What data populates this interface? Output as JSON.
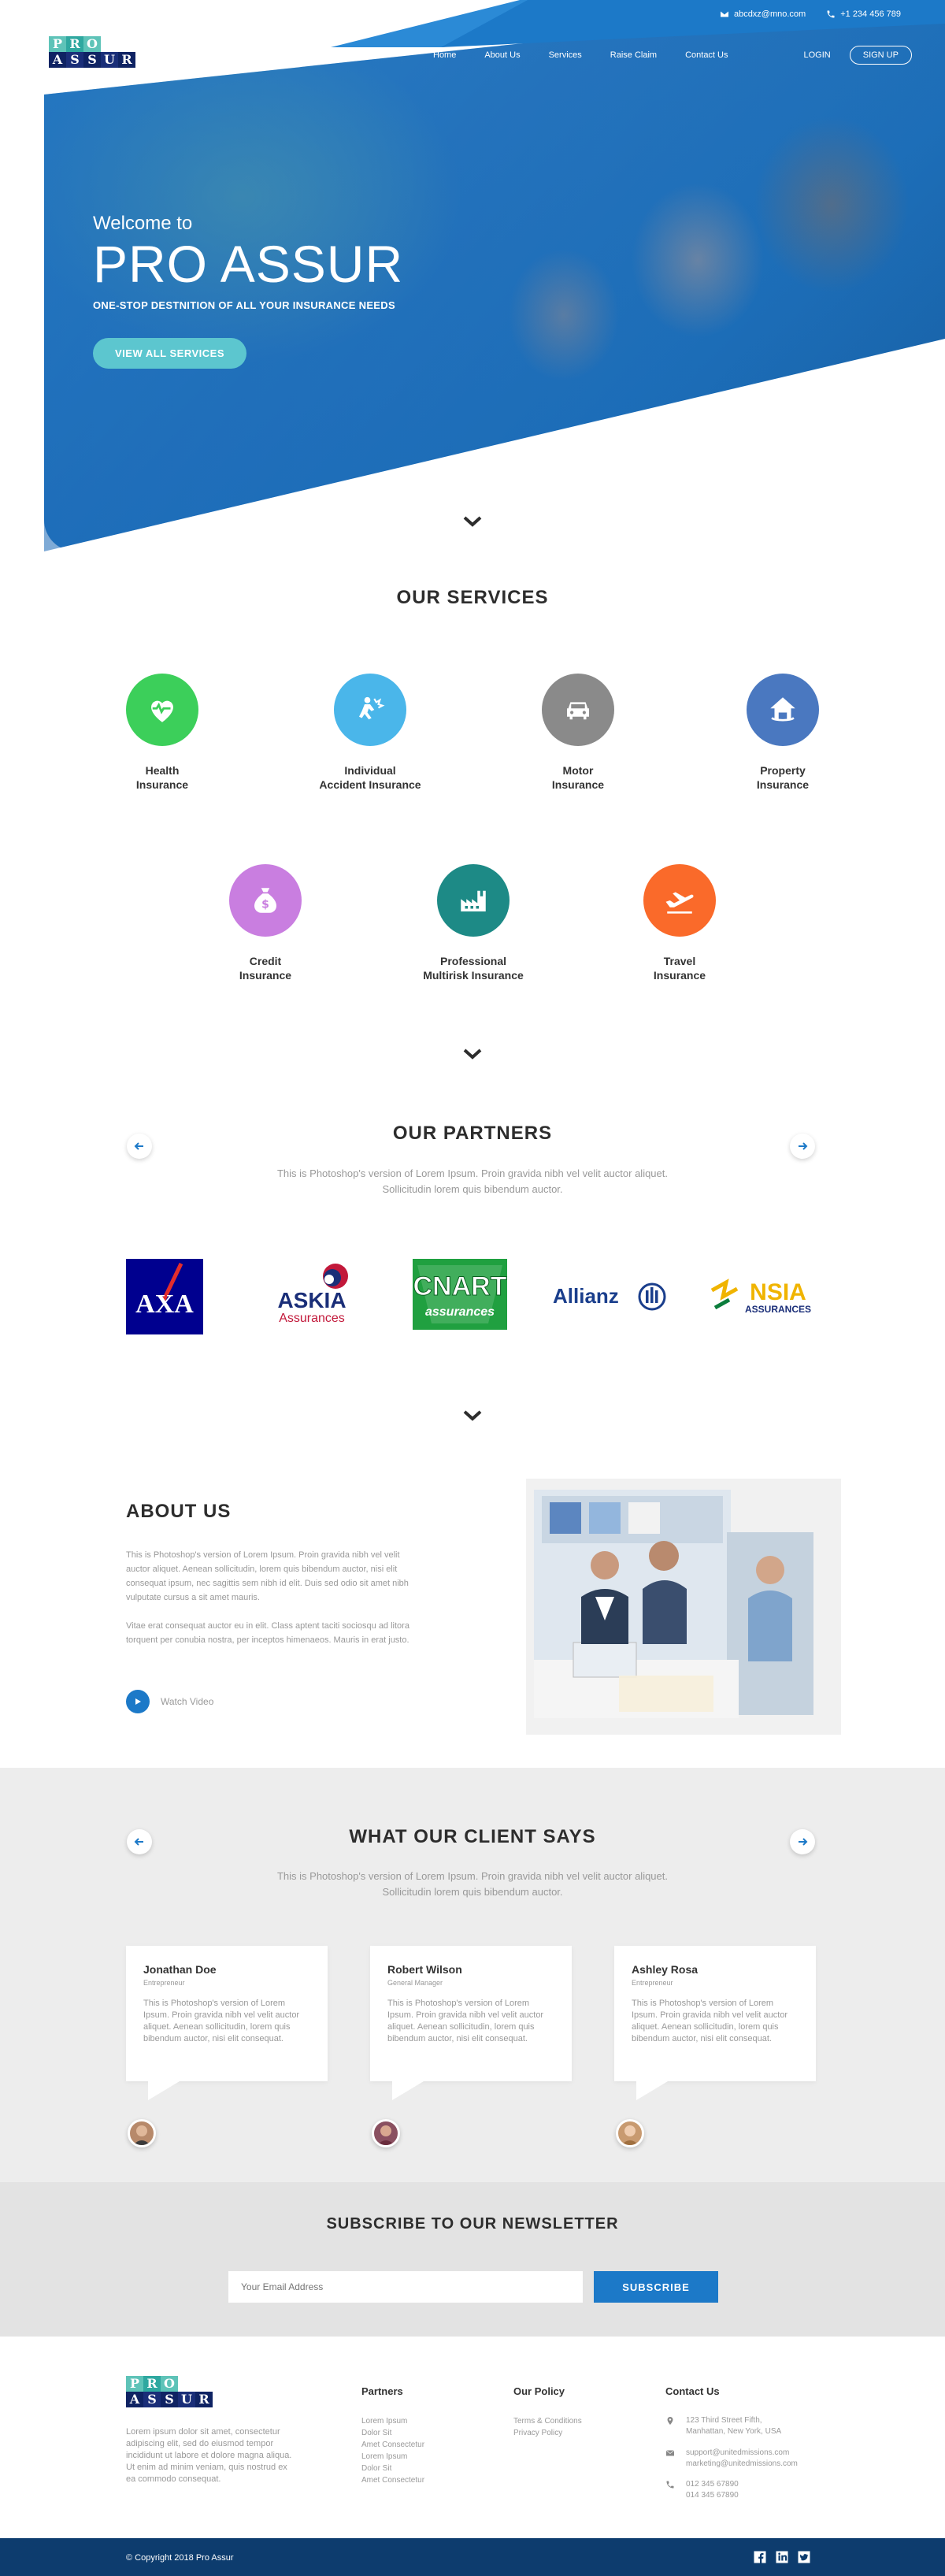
{
  "brand": {
    "logo_top": [
      "P",
      "R",
      "O"
    ],
    "logo_bottom": [
      "A",
      "S",
      "S",
      "U",
      "R"
    ]
  },
  "topbar": {
    "email": "abcdxz@mno.com",
    "phone": "+1 234 456 789"
  },
  "nav": {
    "items": [
      "Home",
      "About Us",
      "Services",
      "Raise Claim",
      "Contact Us"
    ],
    "login": "LOGIN",
    "signup": "SIGN UP"
  },
  "hero": {
    "welcome": "Welcome to",
    "title": "PRO ASSUR",
    "subtitle": "ONE-STOP DESTNITION OF ALL YOUR INSURANCE NEEDS",
    "cta": "VIEW ALL SERVICES"
  },
  "services": {
    "title": "OUR SERVICES",
    "items": [
      {
        "line1": "Health",
        "line2": "Insurance",
        "color": "#3ccf5a",
        "icon": "heart-pulse-icon"
      },
      {
        "line1": "Individual",
        "line2": "Accident Insurance",
        "color": "#4ab6ea",
        "icon": "accident-icon"
      },
      {
        "line1": "Motor",
        "line2": "Insurance",
        "color": "#8a8a8a",
        "icon": "car-icon"
      },
      {
        "line1": "Property",
        "line2": "Insurance",
        "color": "#4a78c0",
        "icon": "house-icon"
      },
      {
        "line1": "Credit",
        "line2": "Insurance",
        "color": "#c97ee0",
        "icon": "money-bag-icon"
      },
      {
        "line1": "Professional",
        "line2": "Multirisk Insurance",
        "color": "#1d8a86",
        "icon": "factory-icon"
      },
      {
        "line1": "Travel",
        "line2": "Insurance",
        "color": "#fa6a2a",
        "icon": "airplane-icon"
      }
    ]
  },
  "partners": {
    "title": "OUR PARTNERS",
    "desc_line1": "This is Photoshop's version  of Lorem Ipsum. Proin gravida nibh vel velit auctor aliquet.",
    "desc_line2": "Sollicitudin lorem quis bibendum auctor.",
    "logos": {
      "axa": "AXA",
      "askia_1": "ASKIA",
      "askia_2": "Assurances",
      "cnart_1": "CNART",
      "cnart_2": "assurances",
      "allianz": "Allianz",
      "nsia_1": "NSIA",
      "nsia_2": "ASSURANCES"
    }
  },
  "about": {
    "title": "ABOUT US",
    "p1": "This is Photoshop's version  of Lorem Ipsum. Proin gravida nibh vel velit auctor aliquet. Aenean sollicitudin, lorem quis bibendum auctor, nisi elit consequat ipsum, nec sagittis sem nibh id elit. Duis sed odio sit amet nibh vulputate cursus a sit amet mauris.",
    "p2": "Vitae erat consequat auctor eu in elit. Class aptent taciti sociosqu ad litora torquent per conubia nostra, per inceptos himenaeos. Mauris in erat justo.",
    "watch": "Watch Video"
  },
  "testimonials": {
    "title": "WHAT OUR CLIENT SAYS",
    "desc_line1": "This is Photoshop's version  of Lorem Ipsum. Proin gravida nibh vel velit auctor aliquet.",
    "desc_line2": "Sollicitudin lorem quis bibendum auctor.",
    "items": [
      {
        "name": "Jonathan Doe",
        "role": "Entrepreneur",
        "text": "This is Photoshop's version  of Lorem Ipsum. Proin gravida nibh vel velit auctor aliquet. Aenean sollicitudin, lorem quis bibendum auctor, nisi elit consequat."
      },
      {
        "name": "Robert Wilson",
        "role": "General Manager",
        "text": "This is Photoshop's version  of Lorem Ipsum. Proin gravida nibh vel velit auctor aliquet. Aenean sollicitudin, lorem quis bibendum auctor, nisi elit consequat."
      },
      {
        "name": "Ashley Rosa",
        "role": "Entrepreneur",
        "text": "This is Photoshop's version  of Lorem Ipsum. Proin gravida nibh vel velit auctor aliquet. Aenean sollicitudin, lorem quis bibendum auctor, nisi elit consequat."
      }
    ]
  },
  "newsletter": {
    "title": "SUBSCRIBE TO OUR NEWSLETTER",
    "placeholder": "Your Email Address",
    "button": "SUBSCRIBE"
  },
  "footer": {
    "about": "Lorem ipsum dolor sit amet, consectetur adipiscing elit, sed do eiusmod tempor incididunt ut labore et dolore magna aliqua. Ut enim ad minim veniam, quis nostrud  ex ea commodo consequat.",
    "partners_title": "Partners",
    "partners_links": [
      "Lorem Ipsum",
      "Dolor Sit",
      "Amet Consectetur",
      "Lorem Ipsum",
      "Dolor Sit",
      "Amet Consectetur"
    ],
    "policy_title": "Our Policy",
    "policy_links": [
      "Terms & Conditions",
      "Privacy Policy"
    ],
    "contact_title": "Contact Us",
    "address_1": "123 Third Street Fifth,",
    "address_2": "Manhattan, New York, USA",
    "email_1": "support@unitedmissions.com",
    "email_2": "marketing@unitedmissions.com",
    "phone_1": "012 345 67890",
    "phone_2": "014 345 67890",
    "copyright": "© Copyright 2018 Pro Assur"
  }
}
